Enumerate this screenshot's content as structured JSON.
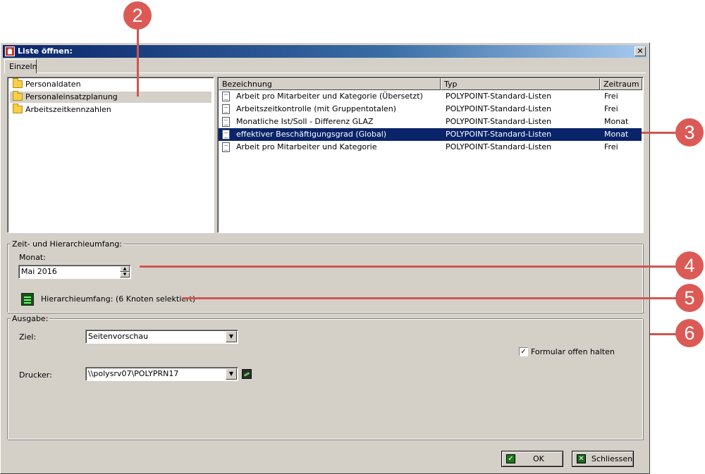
{
  "window": {
    "title": "Liste öffnen:",
    "close_label": "✕"
  },
  "tabs": [
    {
      "label": "Einzeln"
    }
  ],
  "folder_tree": [
    {
      "label": "Personaldaten",
      "selected": false
    },
    {
      "label": "Personaleinsatzplanung",
      "selected": true
    },
    {
      "label": "Arbeitszeitkennzahlen",
      "selected": false
    }
  ],
  "list": {
    "columns": {
      "name": "Bezeichnung",
      "type": "Typ",
      "period": "Zeitraum"
    },
    "rows": [
      {
        "name": "Arbeit pro Mitarbeiter und Kategorie (Übersetzt)",
        "type": "POLYPOINT-Standard-Listen",
        "period": "Frei",
        "selected": false
      },
      {
        "name": "Arbeitszeitkontrolle (mit Gruppentotalen)",
        "type": "POLYPOINT-Standard-Listen",
        "period": "Frei",
        "selected": false
      },
      {
        "name": "Monatliche Ist/Soll - Differenz GLAZ",
        "type": "POLYPOINT-Standard-Listen",
        "period": "Monat",
        "selected": false
      },
      {
        "name": "effektiver Beschäftigungsgrad (Global)",
        "type": "POLYPOINT-Standard-Listen",
        "period": "Monat",
        "selected": true
      },
      {
        "name": "Arbeit pro Mitarbeiter und Kategorie",
        "type": "POLYPOINT-Standard-Listen",
        "period": "Frei",
        "selected": false
      }
    ]
  },
  "scope": {
    "group_label": "Zeit- und Hierarchieumfang:",
    "month_label": "Monat:",
    "month_value": "Mai 2016",
    "hierarchy_text": "Hierarchieumfang: (6 Knoten selektiert)"
  },
  "output": {
    "group_label": "Ausgabe:",
    "target_label": "Ziel:",
    "target_value": "Seitenvorschau",
    "keep_open_label": "Formular offen halten",
    "keep_open_checked": true,
    "printer_label": "Drucker:",
    "printer_value": "\\\\polysrv07\\POLYPRN17"
  },
  "buttons": {
    "ok": "OK",
    "close": "Schliessen"
  },
  "callouts": [
    "2",
    "3",
    "4",
    "5",
    "6"
  ],
  "colors": {
    "callout": "#dc5a55",
    "selection": "#0a246a",
    "dialog_bg": "#d4d0c8"
  }
}
